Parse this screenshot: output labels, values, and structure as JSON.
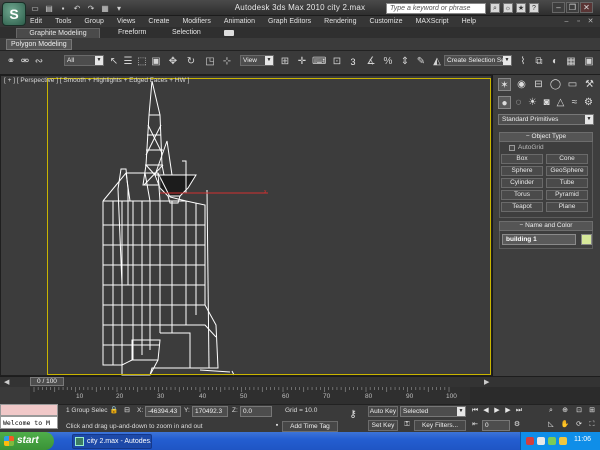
{
  "window": {
    "title": "Autodesk 3ds Max  2010      city 2.max",
    "search_placeholder": "Type a keyword or phrase",
    "logo_glyph": "S"
  },
  "menu": [
    "Edit",
    "Tools",
    "Group",
    "Views",
    "Create",
    "Modifiers",
    "Animation",
    "Graph Editors",
    "Rendering",
    "Customize",
    "MAXScript",
    "Help"
  ],
  "ribbon": {
    "tabs": [
      "Graphite Modeling Tools",
      "Freeform",
      "Selection"
    ],
    "active_tab": "Graphite Modeling Tools",
    "subpanel": "Polygon Modeling"
  },
  "toolbar": {
    "filter_value": "All",
    "refcoord_value": "View",
    "snap_value": "3",
    "selection_set_placeholder": "Create Selection Se"
  },
  "viewport": {
    "label": "[ + ] [ Perspective ] [ Smooth + Highlights + Edged Faces + HW ]",
    "safe_frame_color": "#c8b400",
    "wire_color": "#ffffff"
  },
  "command_panel": {
    "primitive_type": "Standard Primitives",
    "object_type_title": "Object Type",
    "autogrid_label": "AutoGrid",
    "object_buttons": [
      "Box",
      "Cone",
      "Sphere",
      "GeoSphere",
      "Cylinder",
      "Tube",
      "Torus",
      "Pyramid",
      "Teapot",
      "Plane"
    ],
    "name_color_title": "Name and Color",
    "object_name": "building 1",
    "object_color": "#d6e89a"
  },
  "timeline": {
    "frame_display": "0 / 100",
    "ticks": [
      "10",
      "20",
      "30",
      "40",
      "50",
      "60",
      "70",
      "80",
      "90",
      "100"
    ]
  },
  "status": {
    "maxscript_listener": "Welcome to M",
    "selection_info": "1 Group Selec",
    "x_label": "X:",
    "x_value": "-46394.43",
    "y_label": "Y:",
    "y_value": "170492.3",
    "z_label": "Z:",
    "z_value": "0.0",
    "grid": "Grid = 10.0",
    "prompt": "Click and drag up-and-down to zoom in and out",
    "add_time_tag": "Add Time Tag",
    "auto_key": "Auto Key",
    "set_key": "Set Key",
    "key_mode_value": "Selected",
    "key_filters": "Key Filters...",
    "current_frame": "0"
  },
  "taskbar": {
    "start_label": "start",
    "app_label": "city 2.max - Autodes...",
    "clock": "11:06"
  }
}
